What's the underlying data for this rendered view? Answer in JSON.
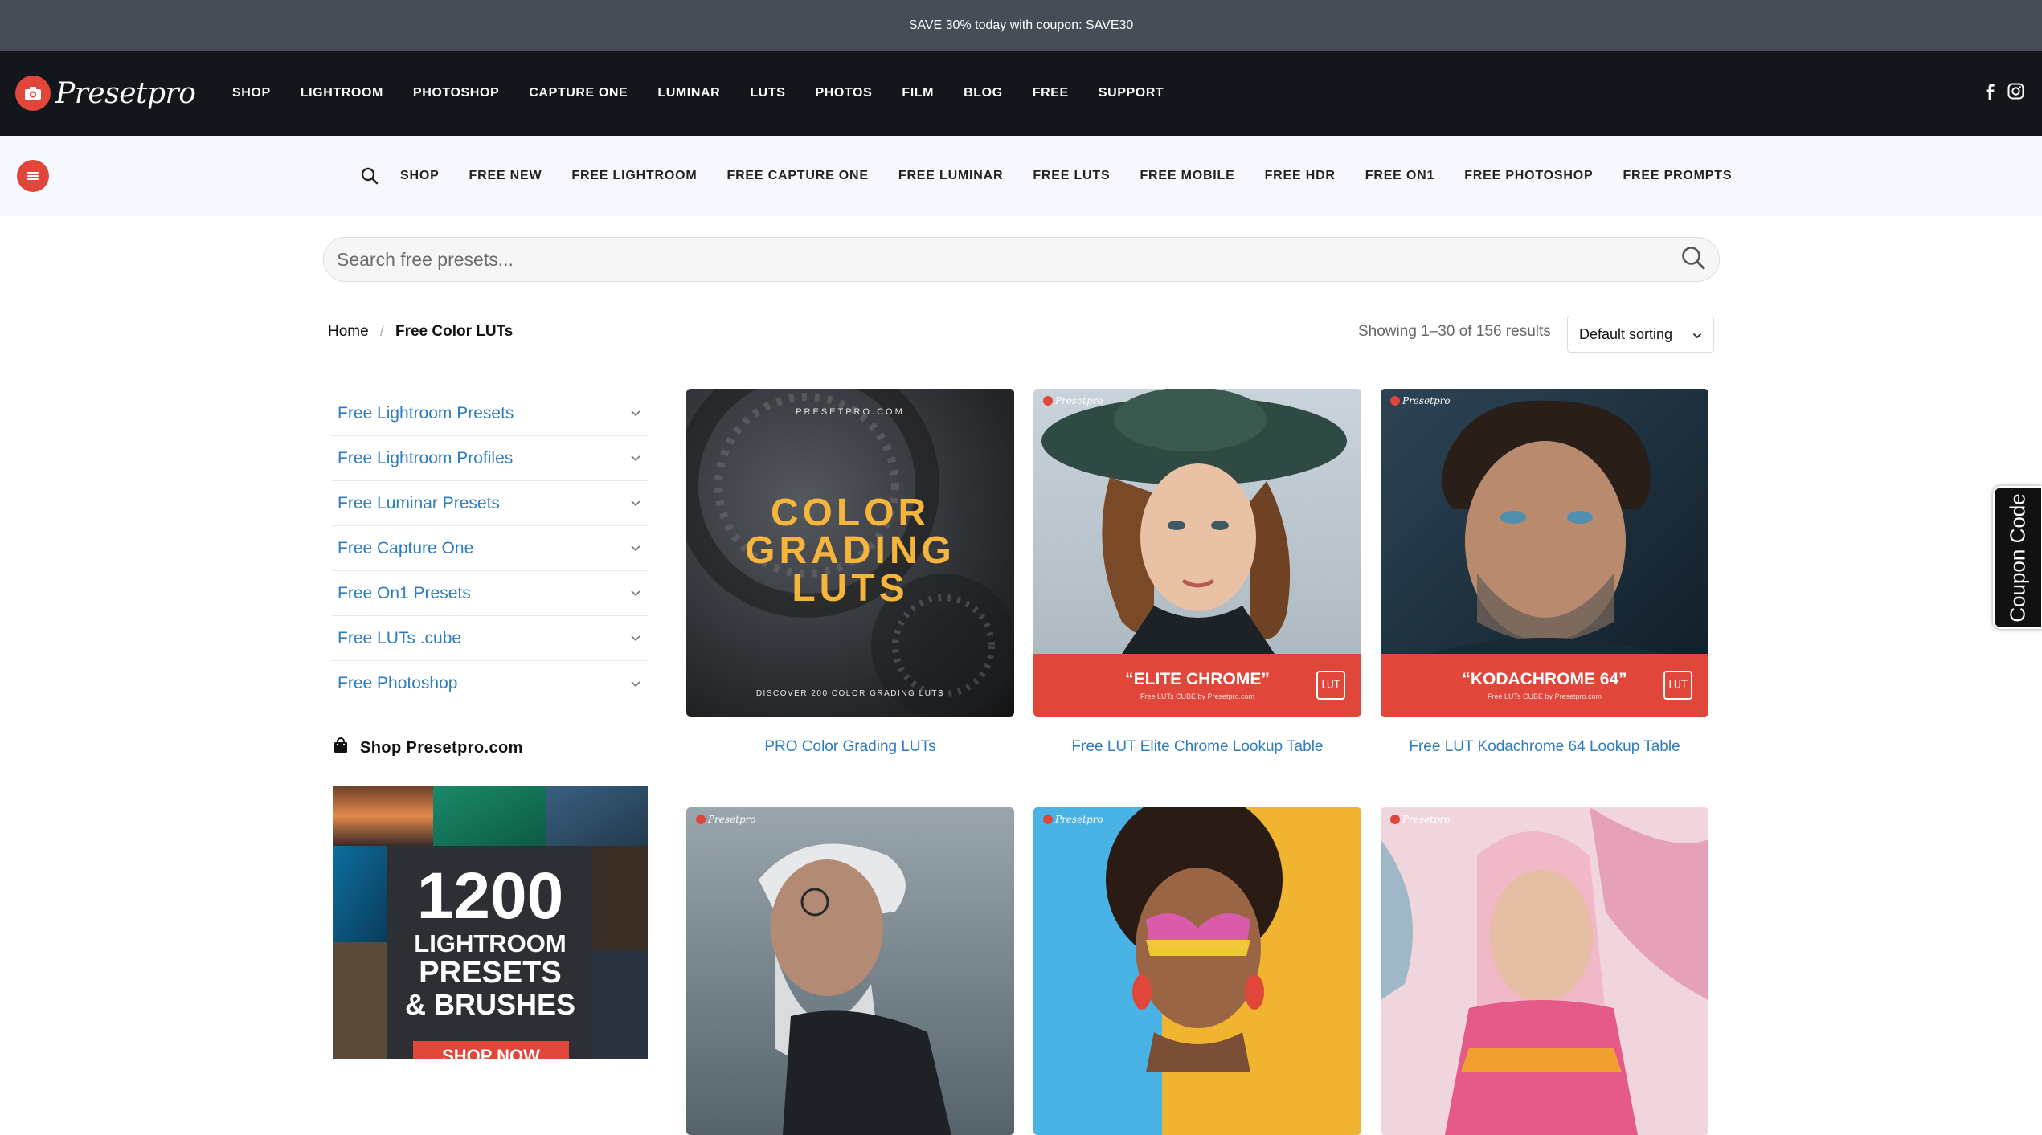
{
  "promo": {
    "text": "SAVE 30% today with coupon: SAVE30"
  },
  "brand": {
    "name": "Presetpro"
  },
  "main_nav": [
    "SHOP",
    "LIGHTROOM",
    "PHOTOSHOP",
    "CAPTURE ONE",
    "LUMINAR",
    "LUTS",
    "PHOTOS",
    "FILM",
    "BLOG",
    "FREE",
    "SUPPORT"
  ],
  "sub_nav": [
    "SHOP",
    "FREE NEW",
    "FREE LIGHTROOM",
    "FREE CAPTURE ONE",
    "FREE LUMINAR",
    "FREE LUTS",
    "FREE MOBILE",
    "FREE HDR",
    "FREE ON1",
    "FREE PHOTOSHOP",
    "FREE PROMPTS"
  ],
  "search": {
    "placeholder": "Search free presets..."
  },
  "breadcrumb": {
    "home": "Home",
    "separator": "/",
    "current": "Free Color LUTs"
  },
  "results": {
    "text": "Showing 1–30 of 156 results"
  },
  "sorting": {
    "selected": "Default sorting"
  },
  "categories": [
    "Free Lightroom Presets",
    "Free Lightroom Profiles",
    "Free Luminar Presets",
    "Free Capture One",
    "Free On1 Presets",
    "Free LUTs .cube",
    "Free Photoshop"
  ],
  "shop_widget": {
    "title": "Shop Presetpro.com",
    "banner_number": "1200",
    "banner_line1": "LIGHTROOM",
    "banner_line2": "PRESETS",
    "banner_line3": "& BRUSHES",
    "banner_cta": "SHOP NOW"
  },
  "products": [
    {
      "title": "PRO Color Grading LUTs",
      "img_site": "PRESETPRO.COM",
      "img_line1": "COLOR",
      "img_line2": "GRADING",
      "img_line3": "LUTS",
      "img_caption": "DISCOVER 200 COLOR GRADING LUTS"
    },
    {
      "title": "Free LUT Elite Chrome Lookup Table",
      "img_title": "“ELITE CHROME”",
      "img_sub": "Free LUTs CUBE by Presetpro.com",
      "badge": "LUT"
    },
    {
      "title": "Free LUT Kodachrome 64 Lookup Table",
      "img_title": "“KODACHROME 64”",
      "img_sub": "Free LUTs CUBE by Presetpro.com",
      "badge": "LUT"
    }
  ],
  "coupon_tab": {
    "label": "Coupon Code"
  },
  "colors": {
    "accent": "#e0463a",
    "link": "#2e7cbf",
    "promo_bg": "#474d57",
    "nav_bg": "#13171b",
    "subnav_bg": "#f6f8fd"
  }
}
